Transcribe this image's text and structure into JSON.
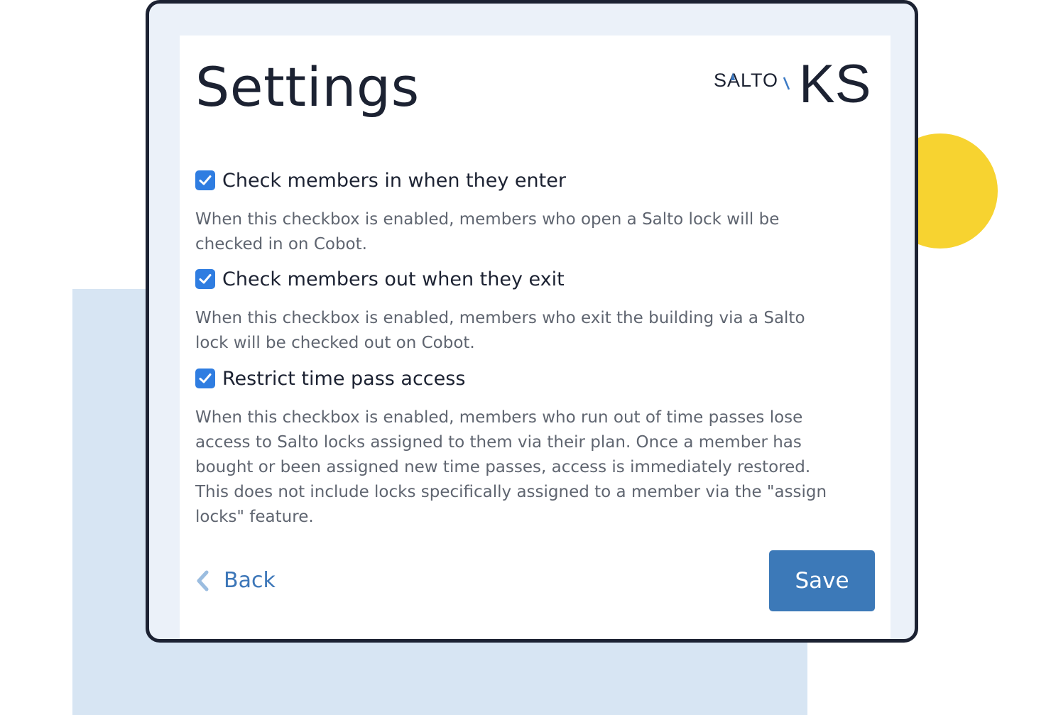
{
  "page": {
    "title": "Settings"
  },
  "logo": {
    "brand_left": "SALTO",
    "brand_right": "KS"
  },
  "settings": [
    {
      "label": "Check members in when they enter",
      "description": "When this checkbox is enabled, members who open a Salto lock will be checked in on Cobot.",
      "checked": true
    },
    {
      "label": "Check members out when they exit",
      "description": "When this checkbox is enabled, members who exit the building via a Salto lock will be checked out on Cobot.",
      "checked": true
    },
    {
      "label": "Restrict time pass access",
      "description": "When this checkbox is enabled, members who run out of time passes lose access to Salto locks assigned to them via their plan. Once a member has bought or been assigned new time passes, access is immediately restored. This does not include locks specifically assigned to a member via the \"assign locks\" feature.",
      "checked": true
    }
  ],
  "actions": {
    "back_label": "Back",
    "save_label": "Save"
  },
  "icons": {
    "checkbox": "check-icon",
    "back": "chevron-left-icon"
  },
  "colors": {
    "accent": "#2f7de1",
    "save_button": "#3c79b8",
    "link": "#3c76b8",
    "highlight_circle": "#f7d330",
    "backdrop": "#d7e5f3"
  }
}
